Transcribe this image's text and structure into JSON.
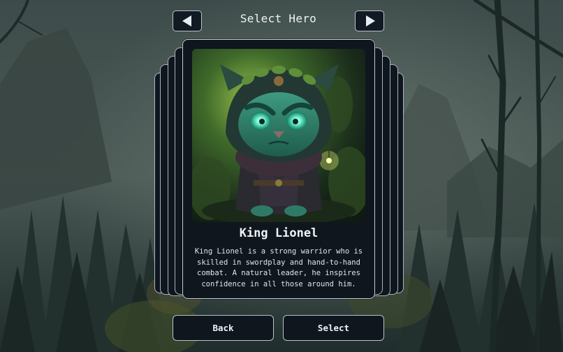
{
  "header": {
    "title": "Select Hero",
    "prev_icon": "left-arrow-icon",
    "next_icon": "right-arrow-icon"
  },
  "hero": {
    "name": "King Lionel",
    "description": "King Lionel is a strong warrior who is skilled in swordplay and hand-to-hand combat. A natural leader, he inspires confidence in all those around him."
  },
  "actions": {
    "back_label": "Back",
    "select_label": "Select"
  },
  "colors": {
    "card_bg": "#0f161e",
    "border": "#c7d0d8",
    "text": "#eef3f7"
  }
}
